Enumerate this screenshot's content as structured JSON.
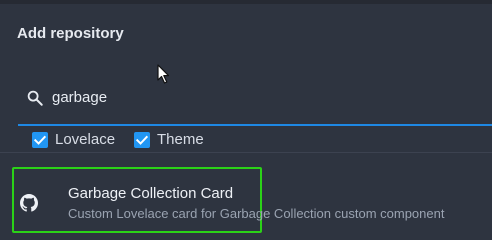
{
  "dialog": {
    "title": "Add repository"
  },
  "search": {
    "value": "garbage",
    "icon": "search-icon"
  },
  "filters": [
    {
      "label": "Lovelace",
      "checked": true
    },
    {
      "label": "Theme",
      "checked": true
    }
  ],
  "results": [
    {
      "name": "Garbage Collection Card",
      "description": "Custom Lovelace card for Garbage Collection custom component",
      "icon": "github-icon"
    }
  ],
  "colors": {
    "accent": "#2196f3",
    "highlight_border": "#2bd217",
    "background": "#2e3440"
  }
}
